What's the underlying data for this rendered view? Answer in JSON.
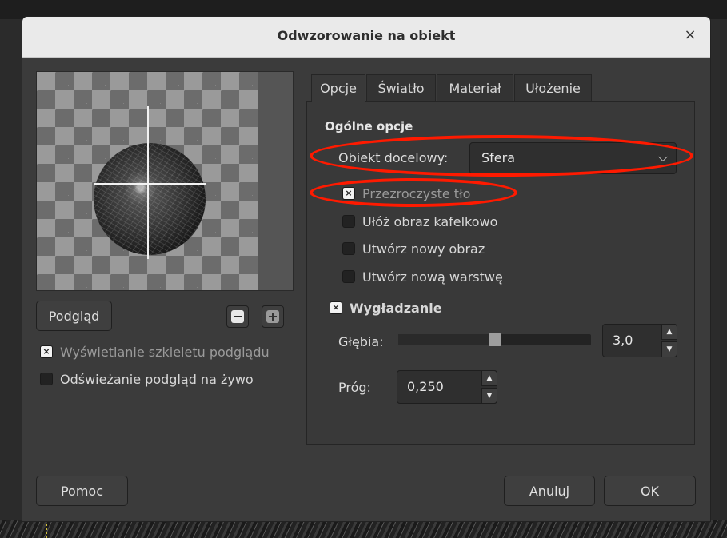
{
  "dialog": {
    "title": "Odwzorowanie na obiekt",
    "close_glyph": "×"
  },
  "preview": {
    "button_label": "Podgląd",
    "zoom_out_icon": "zoom-out-icon",
    "zoom_in_icon": "zoom-in-icon",
    "options": [
      {
        "label": "Wyświetlanie szkieletu podglądu",
        "checked": true
      },
      {
        "label": "Odświeżanie podgląd na żywo",
        "checked": false
      }
    ]
  },
  "tabs": [
    {
      "label": "Opcje",
      "active": true
    },
    {
      "label": "Światło",
      "active": false
    },
    {
      "label": "Materiał",
      "active": false
    },
    {
      "label": "Ułożenie",
      "active": false
    }
  ],
  "general": {
    "section_title": "Ogólne opcje",
    "target_label": "Obiekt docelowy:",
    "target_value": "Sfera",
    "dropdown_glyph": "⌵",
    "options": [
      {
        "label": "Przezroczyste tło",
        "checked": true,
        "disabled": true
      },
      {
        "label": "Ułóż obraz kafelkowo",
        "checked": false
      },
      {
        "label": "Utwórz nowy obraz",
        "checked": false
      },
      {
        "label": "Utwórz nową warstwę",
        "checked": false
      }
    ]
  },
  "antialiasing": {
    "label": "Wygładzanie",
    "checked": true,
    "depth_label": "Głębia:",
    "depth_value": "3,0",
    "depth_fraction": 0.5,
    "threshold_label": "Próg:",
    "threshold_value": "0,250"
  },
  "footer": {
    "help_label": "Pomoc",
    "cancel_label": "Anuluj",
    "ok_label": "OK"
  },
  "annotation_color": "#ff1a00",
  "check_glyph": "×",
  "spin_up_glyph": "▲",
  "spin_down_glyph": "▼"
}
